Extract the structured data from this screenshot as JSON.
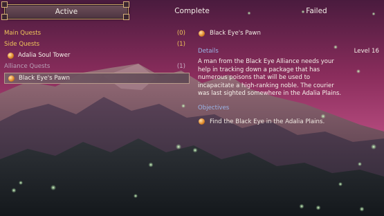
{
  "tabs": {
    "active": "Active",
    "complete": "Complete",
    "failed": "Failed"
  },
  "quest_list": {
    "main_quests": {
      "label": "Main Quests",
      "count": "(0)"
    },
    "side_quests": {
      "label": "Side Quests",
      "count": "(1)"
    },
    "side_items": [
      "Adalia Soul Tower"
    ],
    "alliance_quests": {
      "label": "Alliance Quests",
      "count": "(1)"
    },
    "alliance_items": [
      "Black Eye's Pawn"
    ]
  },
  "details": {
    "quest_title": "Black Eye's Pawn",
    "details_label": "Details",
    "level": "Level 16",
    "description": "A man from the Black Eye Alliance needs your help in tracking down a package that has numerous poisons that will be used to incapacitate a high-ranking noble. The courier was last sighted somewhere in the Adalia Plains.",
    "objectives_label": "Objectives",
    "objectives": [
      "Find the Black Eye in the Adalia Plains."
    ]
  },
  "colors": {
    "category": "#f0c65a",
    "section_heading": "#9bb6e8",
    "sky_top": "#4a1b3e",
    "sky_mid": "#a53a6b"
  }
}
